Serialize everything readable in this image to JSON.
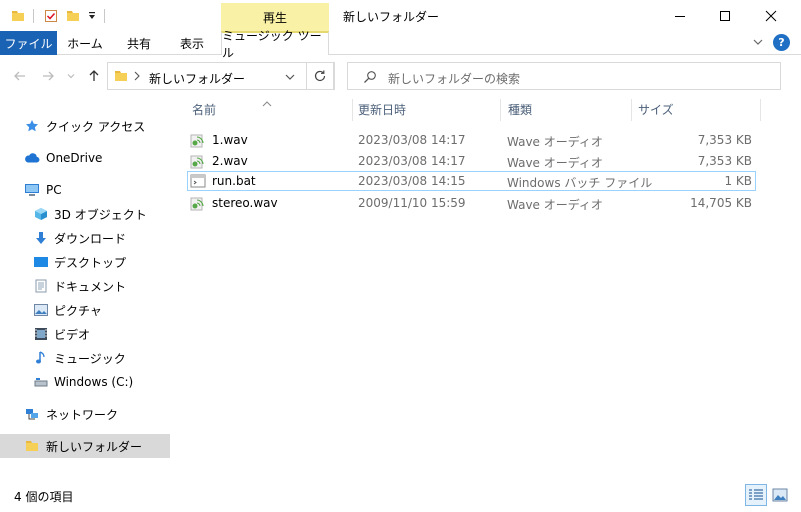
{
  "window": {
    "title": "新しいフォルダー",
    "context_tab_header": "再生"
  },
  "ribbon": {
    "tabs": [
      "ファイル",
      "ホーム",
      "共有",
      "表示",
      "ミュージック ツール"
    ]
  },
  "address": {
    "path_item": "新しいフォルダー"
  },
  "search": {
    "placeholder": "新しいフォルダーの検索"
  },
  "sidebar": {
    "items": [
      {
        "label": "クイック アクセス",
        "icon": "star-icon"
      },
      {
        "label": "OneDrive",
        "icon": "cloud-icon"
      },
      {
        "label": "PC",
        "icon": "computer-icon"
      },
      {
        "label": "3D オブジェクト",
        "icon": "cube-icon"
      },
      {
        "label": "ダウンロード",
        "icon": "download-icon"
      },
      {
        "label": "デスクトップ",
        "icon": "desktop-icon"
      },
      {
        "label": "ドキュメント",
        "icon": "document-icon"
      },
      {
        "label": "ピクチャ",
        "icon": "picture-icon"
      },
      {
        "label": "ビデオ",
        "icon": "video-icon"
      },
      {
        "label": "ミュージック",
        "icon": "music-icon"
      },
      {
        "label": "Windows (C:)",
        "icon": "drive-icon"
      },
      {
        "label": "ネットワーク",
        "icon": "network-icon"
      },
      {
        "label": "新しいフォルダー",
        "icon": "folder-icon"
      }
    ]
  },
  "filelist": {
    "columns": [
      "名前",
      "更新日時",
      "種類",
      "サイズ"
    ],
    "rows": [
      {
        "name": "1.wav",
        "modified": "2023/03/08 14:17",
        "type": "Wave オーディオ",
        "size": "7,353 KB",
        "icon": "audio-file-icon"
      },
      {
        "name": "2.wav",
        "modified": "2023/03/08 14:17",
        "type": "Wave オーディオ",
        "size": "7,353 KB",
        "icon": "audio-file-icon"
      },
      {
        "name": "run.bat",
        "modified": "2023/03/08 14:15",
        "type": "Windows バッチ ファイル",
        "size": "1 KB",
        "icon": "batch-file-icon"
      },
      {
        "name": "stereo.wav",
        "modified": "2009/11/10 15:59",
        "type": "Wave オーディオ",
        "size": "14,705 KB",
        "icon": "audio-file-icon"
      }
    ]
  },
  "status": {
    "item_count": "4 個の項目"
  },
  "colors": {
    "file_tab": "#1a62b4",
    "context_tab": "#f9f1a5",
    "selection": "#d9d9d9",
    "focus_border": "#99d1ff"
  }
}
